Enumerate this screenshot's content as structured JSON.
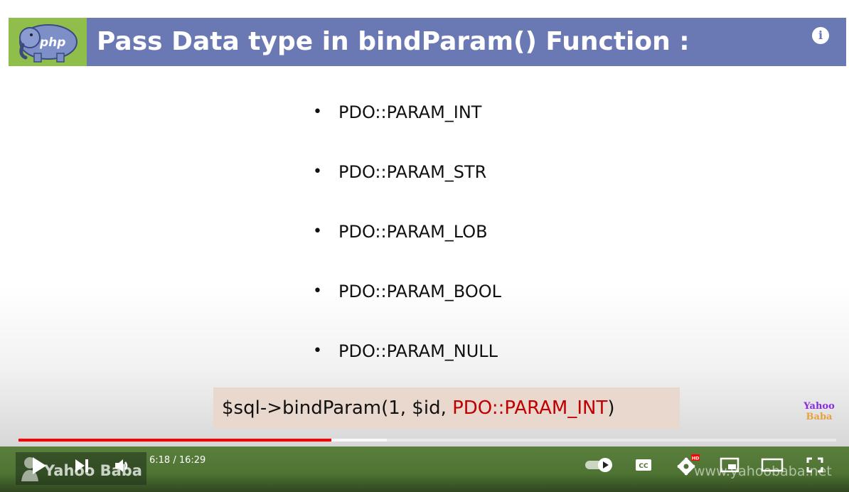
{
  "slide": {
    "title": "Pass Data type in bindParam() Function :",
    "logo_text": "php",
    "bullet_char": "•",
    "bullets": [
      "PDO::PARAM_INT",
      "PDO::PARAM_STR",
      "PDO::PARAM_LOB",
      "PDO::PARAM_BOOL",
      "PDO::PARAM_NULL"
    ],
    "code": {
      "prefix": "$sql->bindParam(1, $id, ",
      "highlight": "PDO::PARAM_INT",
      "suffix": ")"
    },
    "brand_small": {
      "line1": "Yahoo",
      "line2": "Baba"
    }
  },
  "player": {
    "time_display": "6:18 / 16:29",
    "progress_fraction": 0.383,
    "buffered_fraction": 0.45,
    "info_icon_text": "i",
    "hd_badge": "HD",
    "cc_label": "CC",
    "watermark_left": "Yahoo Baba",
    "watermark_right": "www.yahoobaba.net"
  },
  "icons": [
    "play-icon",
    "next-icon",
    "volume-icon",
    "autoplay-toggle-icon",
    "captions-icon",
    "settings-icon",
    "miniplayer-icon",
    "theater-mode-icon",
    "fullscreen-icon",
    "info-icon"
  ],
  "colors": {
    "header_bg": "#6a78b4",
    "logo_bg": "#8fbf4a",
    "code_bg": "#e9d8cd",
    "code_highlight": "#c00000",
    "progress_played": "#ff0000"
  }
}
